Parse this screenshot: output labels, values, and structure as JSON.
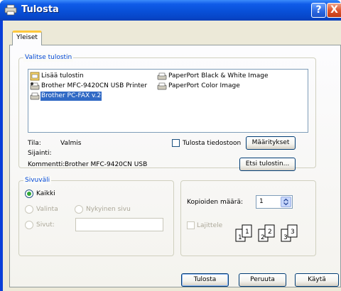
{
  "window": {
    "title": "Tulosta"
  },
  "titlebar": {
    "help": "?",
    "close": "X"
  },
  "tabs": [
    {
      "label": "Yleiset"
    }
  ],
  "printer_group": {
    "label": "Valitse tulostin",
    "items": [
      {
        "label": "Lisää tulostin",
        "icon": "add-printer-icon"
      },
      {
        "label": "Brother MFC-9420CN USB Printer",
        "icon": "default-printer-icon"
      },
      {
        "label": "Brother PC-FAX v.2",
        "icon": "printer-icon",
        "selected": true
      },
      {
        "label": "PaperPort Black & White Image",
        "icon": "printer-icon"
      },
      {
        "label": "PaperPort Color Image",
        "icon": "printer-icon"
      }
    ],
    "status_label": "Tila:",
    "status_value": "Valmis",
    "location_label": "Sijainti:",
    "location_value": "",
    "comment_label": "Kommentti:",
    "comment_value": "Brother MFC-9420CN USB",
    "print_to_file_label": "Tulosta tiedostoon",
    "preferences_button": "Määritykset",
    "find_printer_button": "Etsi tulostin..."
  },
  "page_range_group": {
    "label": "Sivuväli",
    "all_label": "Kaikki",
    "selection_label": "Valinta",
    "current_page_label": "Nykyinen sivu",
    "pages_label": "Sivut:",
    "pages_value": ""
  },
  "copies_group": {
    "copies_label": "Kopioiden määrä:",
    "copies_value": "1",
    "collate_label": "Lajittele",
    "collate_pages": [
      "1",
      "1",
      "2",
      "2",
      "3",
      "3"
    ]
  },
  "footer": {
    "print_button": "Tulosta",
    "cancel_button": "Peruuta",
    "apply_button": "Käytä"
  },
  "colors": {
    "titlebar": "#0850d8",
    "client_bg": "#ece9d8",
    "group_label": "#0046d5",
    "selection": "#316ac5"
  }
}
